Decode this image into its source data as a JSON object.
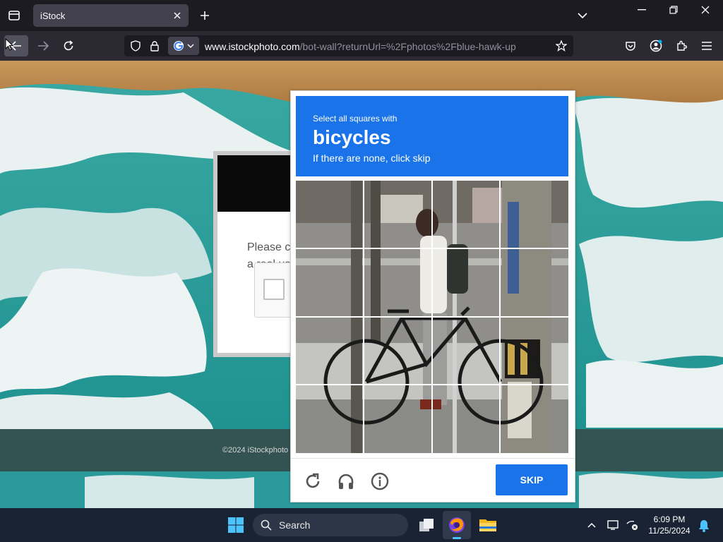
{
  "browser": {
    "tab_title": "iStock",
    "url_domain": "www.istockphoto.com",
    "url_path": "/bot-wall?returnUrl=%2Fphotos%2Fblue-hawk-up"
  },
  "page": {
    "card_line1": "Please c",
    "card_line2": "a real us",
    "footer": "©2024 iStockphoto"
  },
  "captcha": {
    "instruction_small": "Select all squares with",
    "target": "bicycles",
    "instruction_sub": "If there are none, click skip",
    "skip_label": "SKIP",
    "header_color": "#1a73e8"
  },
  "taskbar": {
    "search_label": "Search",
    "time": "6:09 PM",
    "date": "11/25/2024"
  }
}
